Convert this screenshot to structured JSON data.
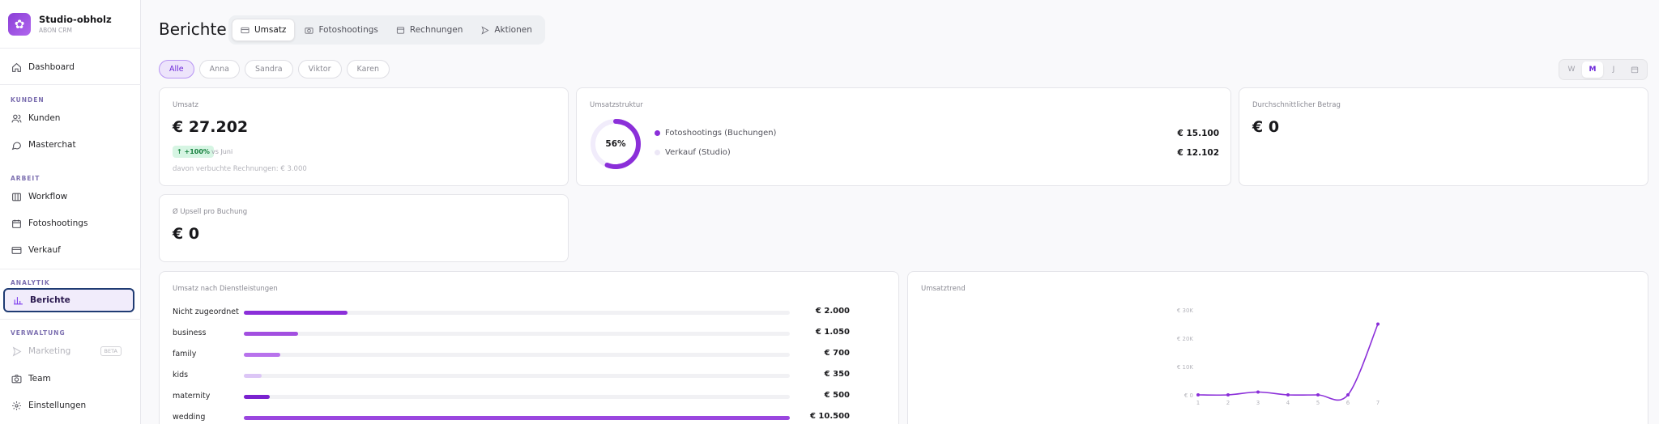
{
  "brand": {
    "name": "Studio-obholz",
    "subtitle": "ABON CRM",
    "logo_icon": "studio-logo"
  },
  "sidebar": {
    "items": [
      {
        "key": "dashboard",
        "label": "Dashboard",
        "icon": "home-icon"
      },
      {
        "key": "kunden",
        "label": "Kunden",
        "icon": "users-icon"
      },
      {
        "key": "masterchat",
        "label": "Masterchat",
        "icon": "chat-icon"
      },
      {
        "key": "workflow",
        "label": "Workflow",
        "icon": "columns-icon"
      },
      {
        "key": "fotoshootings",
        "label": "Fotoshootings",
        "icon": "calendar-icon"
      },
      {
        "key": "verkauf",
        "label": "Verkauf",
        "icon": "card-icon"
      },
      {
        "key": "berichte",
        "label": "Berichte",
        "icon": "bar-chart-icon",
        "active": true
      },
      {
        "key": "marketing",
        "label": "Marketing",
        "icon": "send-icon",
        "disabled": true,
        "badge": "BETA"
      },
      {
        "key": "team",
        "label": "Team",
        "icon": "camera-icon"
      },
      {
        "key": "einstellungen",
        "label": "Einstellungen",
        "icon": "gear-icon"
      }
    ],
    "sections": {
      "kunden": "KUNDEN",
      "arbeit": "ARBEIT",
      "analytik": "ANALYTIK",
      "verwaltung": "VERWALTUNG"
    }
  },
  "header": {
    "title": "Berichte",
    "tabs": [
      {
        "label": "Umsatz",
        "icon": "wallet-icon",
        "active": true
      },
      {
        "label": "Fotoshootings",
        "icon": "camera-icon"
      },
      {
        "label": "Rechnungen",
        "icon": "invoice-icon"
      },
      {
        "label": "Aktionen",
        "icon": "send-icon"
      }
    ]
  },
  "filters": {
    "people": [
      "Alle",
      "Anna",
      "Sandra",
      "Viktor",
      "Karen"
    ],
    "active": "Alle",
    "periods": [
      "W",
      "M",
      "J"
    ],
    "active_period": "M",
    "calendar_icon": "calendar-icon"
  },
  "cards": {
    "umsatz": {
      "label": "Umsatz",
      "value": "€ 27.202",
      "trend": "+100%",
      "trend_vs": "vs Juni",
      "note": "davon verbuchte Rechnungen: € 3.000"
    },
    "struktur": {
      "label": "Umsatzstruktur",
      "percent_label": "56%",
      "percent": 0.56,
      "legend": [
        {
          "label": "Fotoshootings (Buchungen)",
          "value": "€ 15.100",
          "color": "#8b2fd9"
        },
        {
          "label": "Verkauf (Studio)",
          "value": "€ 12.102",
          "color": "#ece7f6"
        }
      ]
    },
    "durchschnitt": {
      "label": "Durchschnittlicher Betrag",
      "value": "€ 0"
    },
    "upsell": {
      "label": "Ø Upsell pro Buchung",
      "value": "€ 0"
    },
    "dienstleistungen": {
      "label": "Umsatz nach Dienstleistungen",
      "rows": [
        {
          "label": "Nicht zugeordnet",
          "value": "€ 2.000",
          "amount": 2000,
          "color": "#8b2fd9"
        },
        {
          "label": "business",
          "value": "€ 1.050",
          "amount": 1050,
          "color": "#a24fe0"
        },
        {
          "label": "family",
          "value": "€ 700",
          "amount": 700,
          "color": "#b872ec"
        },
        {
          "label": "kids",
          "value": "€ 350",
          "amount": 350,
          "color": "#dcc6f6"
        },
        {
          "label": "maternity",
          "value": "€ 500",
          "amount": 500,
          "color": "#7a22cf"
        },
        {
          "label": "wedding",
          "value": "€ 10.500",
          "amount": 10500,
          "color": "#9a46df"
        }
      ]
    },
    "trend": {
      "label": "Umsatztrend"
    }
  },
  "chart_data": {
    "type": "line",
    "x": [
      1,
      2,
      3,
      4,
      5,
      6,
      7
    ],
    "series": [
      {
        "values": [
          0,
          0,
          1000,
          0,
          0,
          0,
          25000
        ],
        "color": "#8b2fd9"
      }
    ],
    "y_ticks": [
      "€ 0",
      "€ 10K",
      "€ 20K",
      "€ 30K"
    ],
    "x_ticks": [
      "1",
      "2",
      "3",
      "4",
      "5",
      "6",
      "7"
    ],
    "ylim": [
      0,
      30000
    ],
    "grid": false
  }
}
